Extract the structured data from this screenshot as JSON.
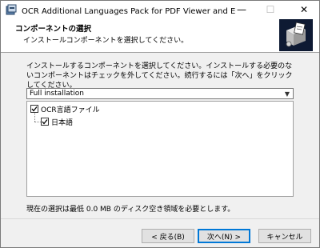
{
  "window": {
    "title": "OCR Additional Languages Pack for PDF Viewer and Editor セ...",
    "minimize_glyph": "—",
    "maximize_glyph": "☐",
    "close_glyph": "✕"
  },
  "header": {
    "title": "コンポーネントの選択",
    "subtitle": "インストールコンポーネントを選択してください。"
  },
  "main": {
    "description": "インストールするコンポーネントを選択してください。インストールする必要のないコンポーネントはチェックを外してください。続行するには「次へ」をクリックしてください。",
    "install_type": {
      "selected": "Full installation"
    },
    "components": [
      {
        "label": "OCR言語ファイル",
        "checked": true,
        "level": 0
      },
      {
        "label": "日本語",
        "checked": true,
        "level": 1
      }
    ],
    "space_required": "現在の選択は最低 0.0 MB のディスク空き領域を必要とします。"
  },
  "footer": {
    "back_label": "< 戻る(B)",
    "next_label": "次へ(N) >",
    "cancel_label": "キャンセル"
  },
  "icons": {
    "app": "installer-icon",
    "header": "install-box-icon",
    "dropdown": "chevron-down-icon",
    "checkbox": "checkmark-icon"
  },
  "colors": {
    "accent": "#0078d7",
    "dialog_bg": "#f0f0f0",
    "header_image_bg": "#0e1a33"
  }
}
